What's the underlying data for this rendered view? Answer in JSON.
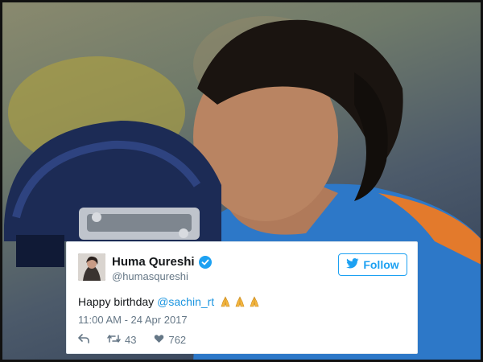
{
  "tweet": {
    "display_name": "Huma Qureshi",
    "handle": "@humasqureshi",
    "follow_label": "Follow",
    "text_prefix": "Happy birthday",
    "mention": "@sachin_rt",
    "emojis": [
      "folded-hands",
      "folded-hands",
      "folded-hands"
    ],
    "timestamp": "11:00 AM - 24 Apr 2017",
    "retweet_count": "43",
    "like_count": "762"
  },
  "colors": {
    "accent": "#1da1f2",
    "mention": "#1b95e0",
    "muted": "#657786",
    "text": "#14171a"
  },
  "icons": {
    "reply": "reply-icon",
    "retweet": "retweet-icon",
    "like": "heart-icon",
    "verified": "verified-badge-icon",
    "twitter": "twitter-bird-icon"
  }
}
